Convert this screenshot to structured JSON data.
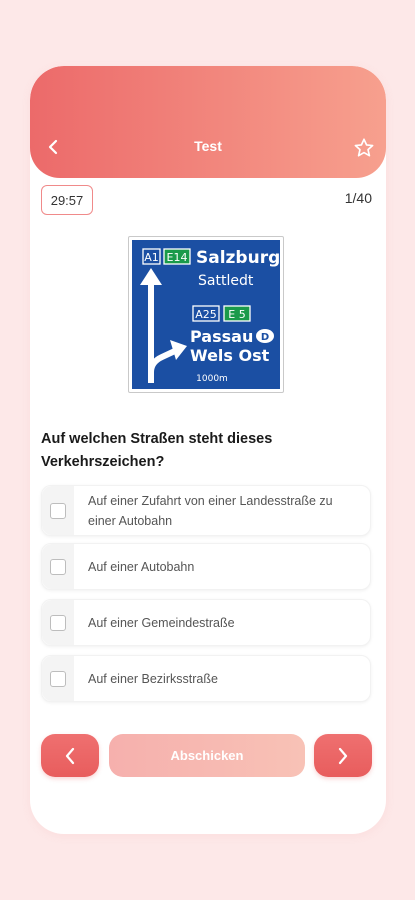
{
  "header": {
    "title": "Test",
    "back_icon": "chevron-left-icon",
    "favorite_icon": "star-outline-icon"
  },
  "status": {
    "timer": "29:57",
    "counter": "1/40"
  },
  "sign": {
    "line1": {
      "badges": [
        "A1",
        "E14"
      ],
      "city": "Salzburg"
    },
    "line2": {
      "city": "Sattledt"
    },
    "line3": {
      "badges": [
        "A25",
        "E 5"
      ]
    },
    "line4": {
      "city": "Passau",
      "country": "D"
    },
    "line5": {
      "city": "Wels Ost"
    },
    "distance": "1000m"
  },
  "question": "Auf welchen Straßen steht dieses Verkehrszeichen?",
  "options": [
    {
      "label": "Auf einer Zufahrt von einer Landesstraße zu einer Autobahn",
      "checked": false
    },
    {
      "label": "Auf einer Autobahn",
      "checked": false
    },
    {
      "label": "Auf einer Gemeindestraße",
      "checked": false
    },
    {
      "label": "Auf einer Bezirksstraße",
      "checked": false
    }
  ],
  "footer": {
    "submit_label": "Abschicken",
    "prev_icon": "chevron-left-icon",
    "next_icon": "chevron-right-icon"
  },
  "colors": {
    "accent": "#e85d5d",
    "sign_blue": "#1b4fa3",
    "sign_green": "#1a9a4a",
    "background": "#fde8e8"
  }
}
